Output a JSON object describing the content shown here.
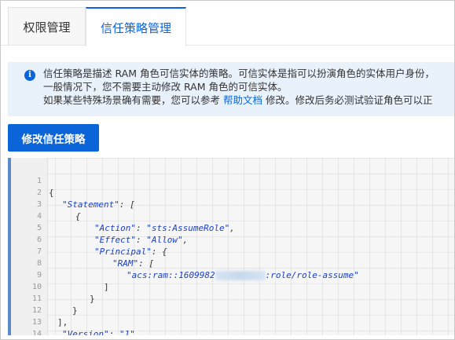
{
  "tabs": [
    {
      "label": "权限管理"
    },
    {
      "label": "信任策略管理"
    }
  ],
  "notice": {
    "line1": "信任策略是描述 RAM 角色可信实体的策略。可信实体是指可以扮演角色的实体用户身份，",
    "line2": "一般情况下，您不需要主动修改 RAM 角色的可信实体。",
    "line3_prefix": "如果某些特殊场景确有需要，您可以参考 ",
    "line3_link": "帮助文档",
    "line3_suffix": " 修改。修改后务必测试验证角色可以正"
  },
  "button": {
    "label": "修改信任策略"
  },
  "editor": {
    "line_numbers": [
      "1",
      "2",
      "3",
      "4",
      "5",
      "6",
      "7",
      "8",
      "9",
      "10",
      "11",
      "12",
      "13",
      "14"
    ],
    "lines": {
      "l1": "{",
      "l2_key": "\"Statement\"",
      "l2_rest": ": [",
      "l3": "{",
      "l4_key": "\"Action\"",
      "l4_mid": ": ",
      "l4_val": "\"sts:AssumeRole\"",
      "l4_end": ",",
      "l5_key": "\"Effect\"",
      "l5_mid": ": ",
      "l5_val": "\"Allow\"",
      "l5_end": ",",
      "l6_key": "\"Principal\"",
      "l6_rest": ": {",
      "l7_key": "\"RAM\"",
      "l7_rest": ": [",
      "l8_val_a": "\"acs:ram::1609982",
      "l8_val_b": ":role/role-assume\"",
      "l9": "]",
      "l10": "}",
      "l11": "}",
      "l12": "],",
      "l13_key": "\"Version\"",
      "l13_mid": ": ",
      "l13_val": "\"1\"",
      "l14": "}"
    }
  }
}
